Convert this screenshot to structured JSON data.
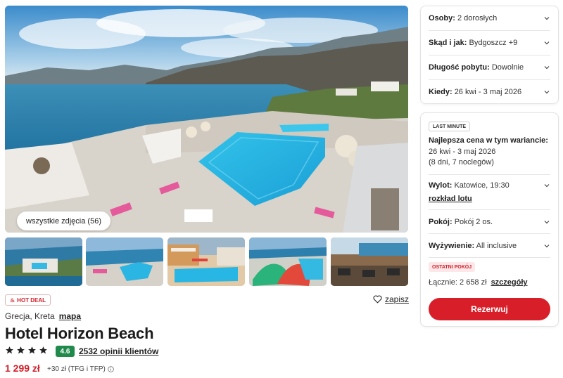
{
  "gallery": {
    "all_photos_label": "wszystkie zdjęcia (56)",
    "thumbnails": [
      "thumb-1",
      "thumb-2",
      "thumb-3",
      "thumb-4",
      "thumb-5"
    ]
  },
  "hotel": {
    "hot_deal_label": "HOT DEAL",
    "save_label": "zapisz",
    "location": "Grecja, Kreta",
    "map_label": "mapa",
    "name": "Hotel Horizon Beach",
    "stars": 4,
    "rating": "4.6",
    "reviews_label": "2532 opinii klientów",
    "price": "1 299 zł",
    "price_extra": "+30 zł (TFG i TFP)"
  },
  "filters": {
    "persons": {
      "label": "Osoby:",
      "value": "2 dorosłych"
    },
    "origin": {
      "label": "Skąd i jak:",
      "value": "Bydgoszcz +9"
    },
    "duration": {
      "label": "Długość pobytu:",
      "value": "Dowolnie"
    },
    "when": {
      "label": "Kiedy:",
      "value": "26 kwi - 3 maj 2026"
    }
  },
  "offer": {
    "last_minute_label": "LAST MINUTE",
    "best_price_title": "Najlepsza cena w tym wariancie:",
    "dates": "26 kwi - 3 maj 2026",
    "nights": "(8 dni, 7 noclegów)",
    "flight": {
      "label": "Wylot:",
      "value": "Katowice, 19:30"
    },
    "flight_schedule_label": "rozkład lotu",
    "room": {
      "label": "Pokój:",
      "value": "Pokój 2 os."
    },
    "board": {
      "label": "Wyżywienie:",
      "value": "All inclusive"
    },
    "last_room_label": "OSTATNI POKÓJ",
    "total_label": "Łącznie: 2 658 zł",
    "details_label": "szczegóły",
    "book_label": "Rezerwuj"
  },
  "colors": {
    "accent_red": "#d81e29",
    "rating_green": "#1f8a4c",
    "price_red": "#d0202b"
  }
}
